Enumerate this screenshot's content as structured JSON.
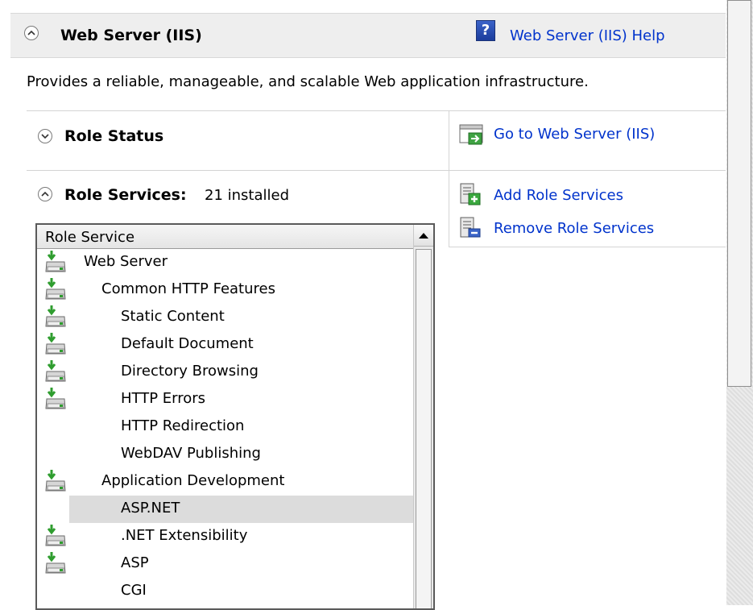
{
  "header": {
    "title": "Web Server (IIS)",
    "help_link": "Web Server (IIS) Help",
    "help_icon": "help-icon"
  },
  "description": "Provides a reliable, manageable, and scalable Web application infrastructure.",
  "role_status": {
    "title": "Role Status",
    "task": "Go to Web Server (IIS)"
  },
  "role_services": {
    "title": "Role Services:",
    "subtitle": "21 installed",
    "tasks": [
      "Add Role Services",
      "Remove Role Services"
    ],
    "column_header": "Role Service",
    "items": [
      {
        "label": "Web Server",
        "installed": true
      },
      {
        "label": "Common HTTP Features",
        "installed": true
      },
      {
        "label": "Static Content",
        "installed": true
      },
      {
        "label": "Default Document",
        "installed": true
      },
      {
        "label": "Directory Browsing",
        "installed": true
      },
      {
        "label": "HTTP Errors",
        "installed": true
      },
      {
        "label": "HTTP Redirection",
        "installed": false
      },
      {
        "label": "WebDAV Publishing",
        "installed": false
      },
      {
        "label": "Application Development",
        "installed": true
      },
      {
        "label": "ASP.NET",
        "installed": false,
        "selected": true
      },
      {
        "label": ".NET Extensibility",
        "installed": true
      },
      {
        "label": "ASP",
        "installed": true
      },
      {
        "label": "CGI",
        "installed": false
      }
    ]
  },
  "colors": {
    "link": "#0033cc",
    "header_bg": "#eeeeee",
    "selected_row": "#dcdcdc"
  }
}
